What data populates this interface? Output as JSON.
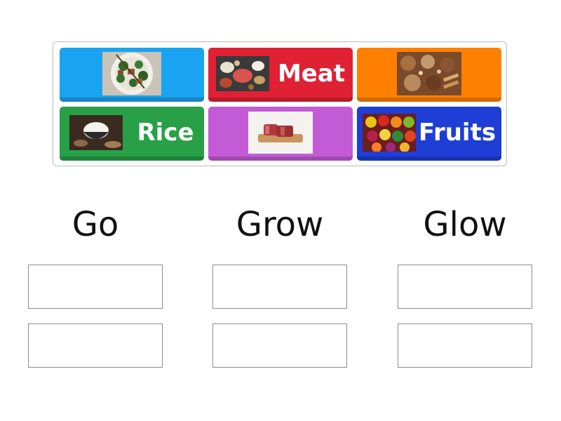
{
  "tiles": [
    {
      "label": "",
      "color": "#1aa3f0",
      "image": "chicken-broccoli-rice-bowl"
    },
    {
      "label": "Meat",
      "color": "#e02033",
      "image": "assorted-protein-foods"
    },
    {
      "label": "",
      "color": "#ff8000",
      "image": "nuts-grains-legumes"
    },
    {
      "label": "Rice",
      "color": "#27a047",
      "image": "rice-in-bowl"
    },
    {
      "label": "",
      "color": "#c35bd6",
      "image": "raw-beef-on-board"
    },
    {
      "label": "Fruits",
      "color": "#1e3ed6",
      "image": "assorted-fruits-vegetables"
    }
  ],
  "categories": [
    {
      "label": "Go"
    },
    {
      "label": "Grow"
    },
    {
      "label": "Glow"
    }
  ],
  "colors": {
    "slot_border": "#8c8c8c",
    "tray_border": "#b9b9b9"
  }
}
